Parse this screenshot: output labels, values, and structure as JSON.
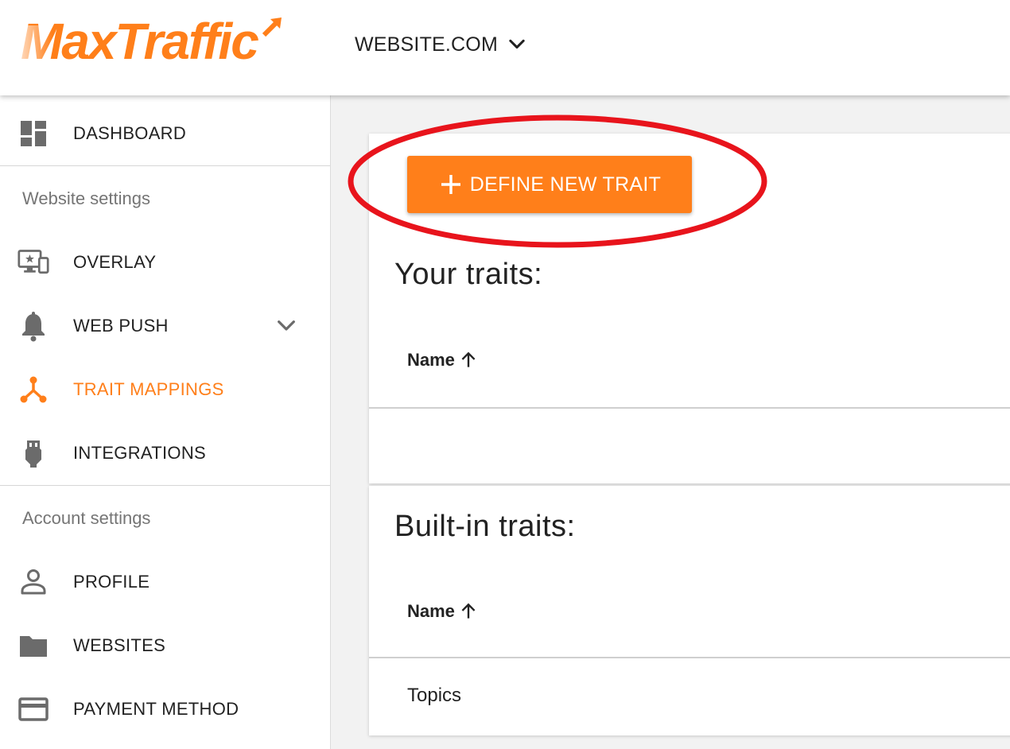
{
  "header": {
    "logo_text": "MaxTraffic",
    "site_selector": "WEBSITE.COM"
  },
  "sidebar": {
    "dashboard": "DASHBOARD",
    "website_settings_title": "Website settings",
    "overlay": "OVERLAY",
    "web_push": "WEB PUSH",
    "trait_mappings": "TRAIT MAPPINGS",
    "integrations": "INTEGRATIONS",
    "account_settings_title": "Account settings",
    "profile": "PROFILE",
    "websites": "WEBSITES",
    "payment_method": "PAYMENT METHOD",
    "active_item": "TRAIT MAPPINGS"
  },
  "main": {
    "define_button": "DEFINE NEW TRAIT",
    "your_traits": {
      "title": "Your traits:",
      "column_header": "Name",
      "rows": []
    },
    "builtin_traits": {
      "title": "Built-in traits:",
      "column_header": "Name",
      "rows": [
        "Topics"
      ]
    }
  },
  "colors": {
    "accent": "#ff7f1a",
    "annotation": "#e8141c"
  }
}
